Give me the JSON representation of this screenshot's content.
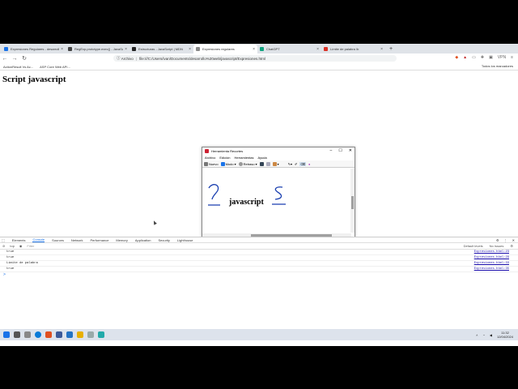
{
  "tabs": [
    {
      "title": "Expresiones Regulares - desarrollo",
      "color": "#1a73e8",
      "active": false
    },
    {
      "title": "RegExp.prototype.exec() - JavaScript",
      "color": "#444",
      "active": false
    },
    {
      "title": "Estructuras - JavaScript | MDN",
      "color": "#222",
      "active": false
    },
    {
      "title": "Expresiones regulares",
      "color": "#888",
      "active": true
    },
    {
      "title": "ChatGPT",
      "color": "#10a37f",
      "active": false
    },
    {
      "title": "Límite de palabra \\b",
      "color": "#d93025",
      "active": false
    }
  ],
  "address": {
    "scheme": "Archivo",
    "url": "file:///C:/Users/ivan/Documents/desarrollo%20web/javascript/Expresiones.html"
  },
  "bookmarks": [
    "ActionResult Vs Ac...",
    "ASP Core Web API..."
  ],
  "bookmarks_right": "Todos los marcadores",
  "page": {
    "heading": "Script javascript"
  },
  "snip": {
    "title": "Herramienta Recortes",
    "menu": [
      "Archivo",
      "Edición",
      "Herramientas",
      "Ayuda"
    ],
    "tools": {
      "new": "Nuevo",
      "mode": "Modo",
      "delay": "Retraso"
    },
    "content": "javascript"
  },
  "devtools": {
    "tabs": [
      "Elements",
      "Console",
      "Sources",
      "Network",
      "Performance",
      "Memory",
      "Application",
      "Security",
      "Lighthouse"
    ],
    "active_tab": "Console",
    "context": "top",
    "filter_placeholder": "Filter",
    "levels": "Default levels",
    "issues": "No Issues",
    "logs": [
      {
        "text": "true",
        "src": "Expresiones.html:23"
      },
      {
        "text": "true",
        "src": "Expresiones.html:29"
      },
      {
        "text": "Límite de palabra",
        "src": "Expresiones.html:33"
      },
      {
        "text": "true",
        "src": "Expresiones.html:35"
      }
    ],
    "prompt": ">"
  },
  "taskbar": {
    "time": "11:32",
    "date": "12/04/2024"
  }
}
